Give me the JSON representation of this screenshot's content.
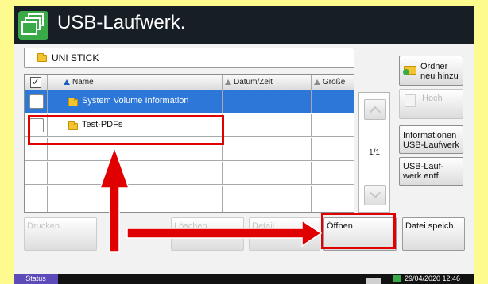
{
  "header": {
    "title": "USB-Laufwerk.",
    "icon": "copy-documents-icon"
  },
  "path": {
    "folder_icon": "folder-icon",
    "text": "UNI STICK"
  },
  "table": {
    "columns": [
      "Name",
      "Datum/Zeit",
      "Größe"
    ],
    "rows": [
      {
        "name": "System Volume Information",
        "selected": true
      },
      {
        "name": "Test-PDFs",
        "selected": false
      },
      {
        "name": "",
        "selected": false
      },
      {
        "name": "",
        "selected": false
      },
      {
        "name": "",
        "selected": false
      }
    ]
  },
  "pager": {
    "page": "1/1"
  },
  "side": {
    "new_folder": "Ordner\nneu hinzu",
    "up": "Hoch",
    "usb_info": "Informationen\nUSB-Laufwerk",
    "remove_usb": "USB-Lauf-\nwerk entf."
  },
  "bottom": {
    "print": "Drucken",
    "delete": "Löschen",
    "details": "Detail",
    "open": "Öffnen",
    "save_file": "Datei speich."
  },
  "status": {
    "label": "Status",
    "datetime": "29/04/2020 12:46"
  },
  "colors": {
    "header": "#171e26",
    "selection": "#2d77d8",
    "highlight": "#e00000",
    "page": "#fdfb8e",
    "status_label": "#5c4bb8"
  }
}
